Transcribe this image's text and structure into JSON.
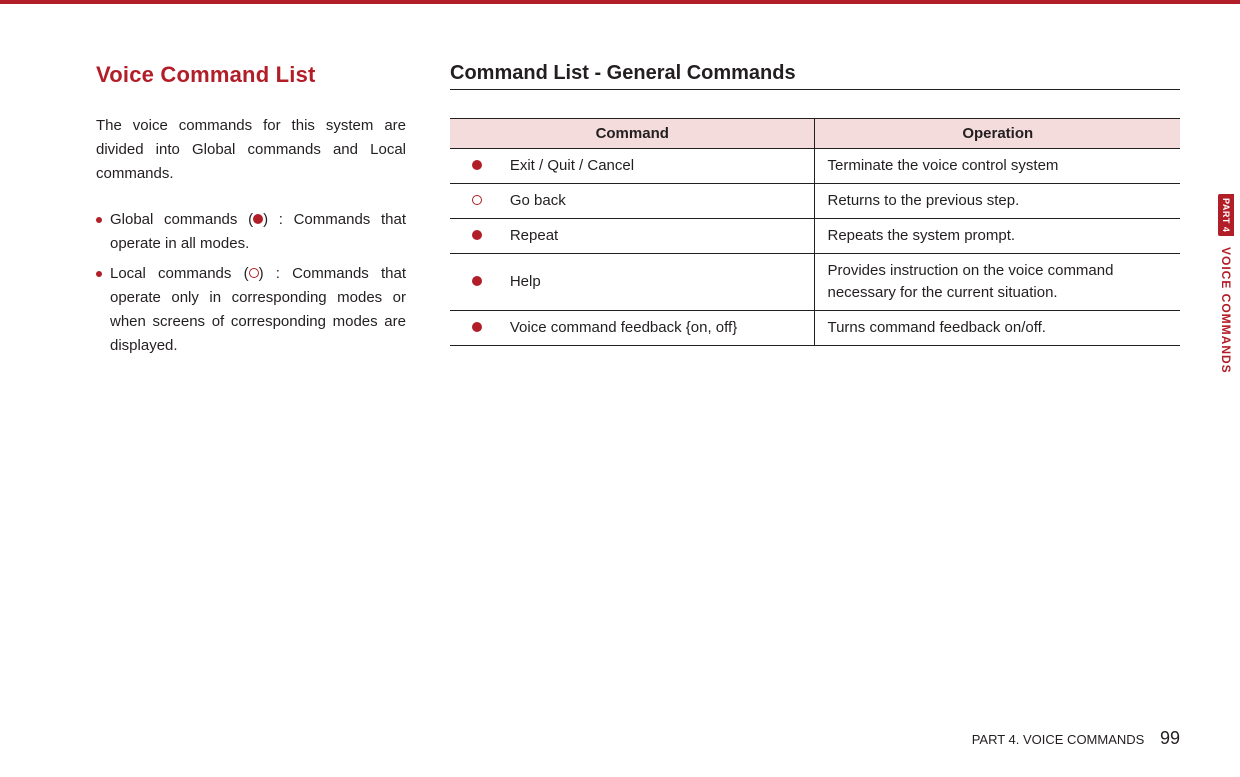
{
  "left": {
    "heading": "Voice Command List",
    "intro": "The voice commands for this system are divided into Global commands and Local commands.",
    "defs": {
      "global_pre": "Global commands (",
      "global_post": ") : Commands that operate in all modes.",
      "local_pre": "Local commands (",
      "local_post": ") : Commands that operate only in corresponding modes or when screens of corresponding modes are displayed."
    }
  },
  "right": {
    "heading": "Command List - General Commands",
    "headers": {
      "command": "Command",
      "operation": "Operation"
    },
    "rows": [
      {
        "marker": "filled",
        "command": "Exit / Quit / Cancel",
        "operation": "Terminate the voice control system"
      },
      {
        "marker": "outline",
        "command": "Go back",
        "operation": "Returns to the previous step."
      },
      {
        "marker": "filled",
        "command": "Repeat",
        "operation": "Repeats the system prompt."
      },
      {
        "marker": "filled",
        "command": "Help",
        "operation": "Provides instruction on the voice command necessary for the current situation."
      },
      {
        "marker": "filled",
        "command": "Voice command feedback {on, off}",
        "operation": "Turns command feedback on/off."
      }
    ]
  },
  "side": {
    "part": "PART 4",
    "label": "VOICE COMMANDS"
  },
  "footer": {
    "section": "PART 4. VOICE COMMANDS",
    "page": "99"
  }
}
